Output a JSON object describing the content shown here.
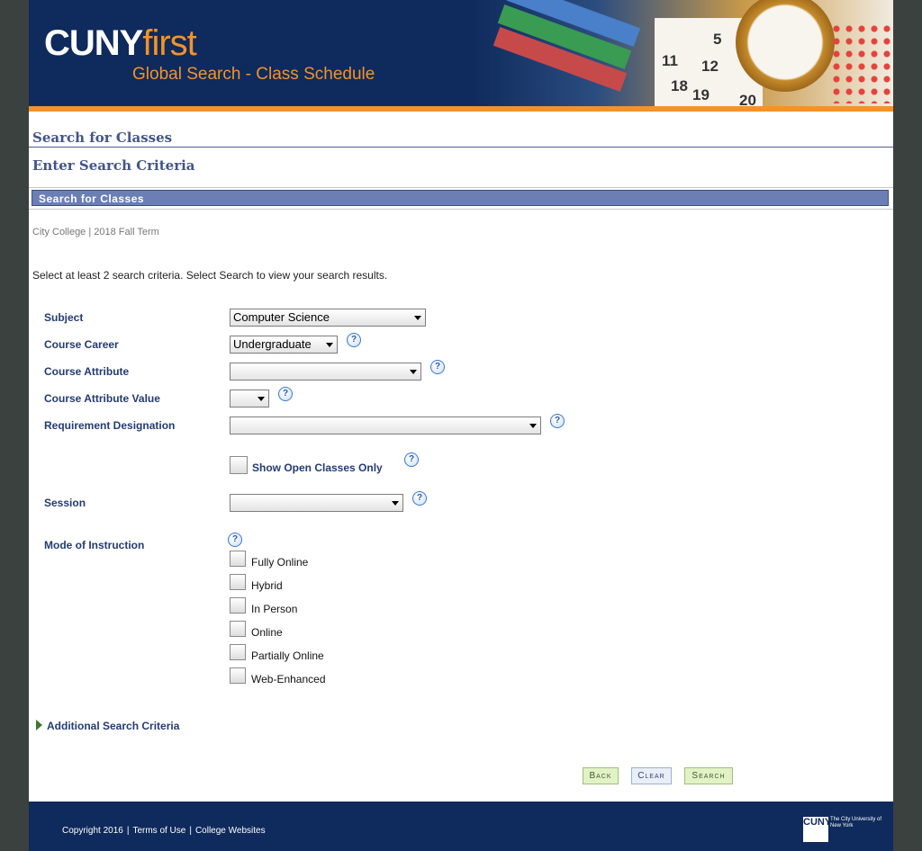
{
  "banner": {
    "brand_main": "CUNY",
    "brand_accent": "first",
    "subtitle": "Global Search - Class Schedule",
    "calendar_numbers": [
      "5",
      "11",
      "12",
      "18",
      "19",
      "20"
    ]
  },
  "page": {
    "title": "Search for Classes",
    "subtitle": "Enter Search Criteria",
    "section_header": "Search for Classes",
    "context": "City College | 2018 Fall Term",
    "instruction": "Select at least 2 search criteria. Select Search to view your search results."
  },
  "form": {
    "subject_label": "Subject",
    "subject_value": "Computer Science",
    "career_label": "Course Career",
    "career_value": "Undergraduate",
    "attribute_label": "Course Attribute",
    "attribute_value": "",
    "attribute_value_label": "Course Attribute Value",
    "attribute_value_value": "",
    "requirement_label": "Requirement Designation",
    "requirement_value": "",
    "open_classes_label": "Show Open Classes Only",
    "session_label": "Session",
    "session_value": "",
    "mode_label": "Mode of Instruction",
    "modes": [
      "Fully Online",
      "Hybrid",
      "In Person",
      "Online",
      "Partially Online",
      "Web-Enhanced"
    ],
    "help_glyph": "?"
  },
  "additional": {
    "label": "Additional Search Criteria"
  },
  "buttons": {
    "back": "Back",
    "clear": "Clear",
    "search": "Search"
  },
  "footer": {
    "copyright": "Copyright 2016",
    "terms": "Terms of Use",
    "colleges": "College Websites",
    "logo_letters": "CUNY",
    "logo_text": "The City University of New York"
  },
  "colors": {
    "navy": "#0f2a5c",
    "orange": "#f2932a",
    "section_blue": "#6b7fb5",
    "label_blue": "#243b73"
  },
  "icons": [
    "help-icon",
    "dropdown-arrow-icon",
    "expand-triangle-icon",
    "checkbox"
  ]
}
